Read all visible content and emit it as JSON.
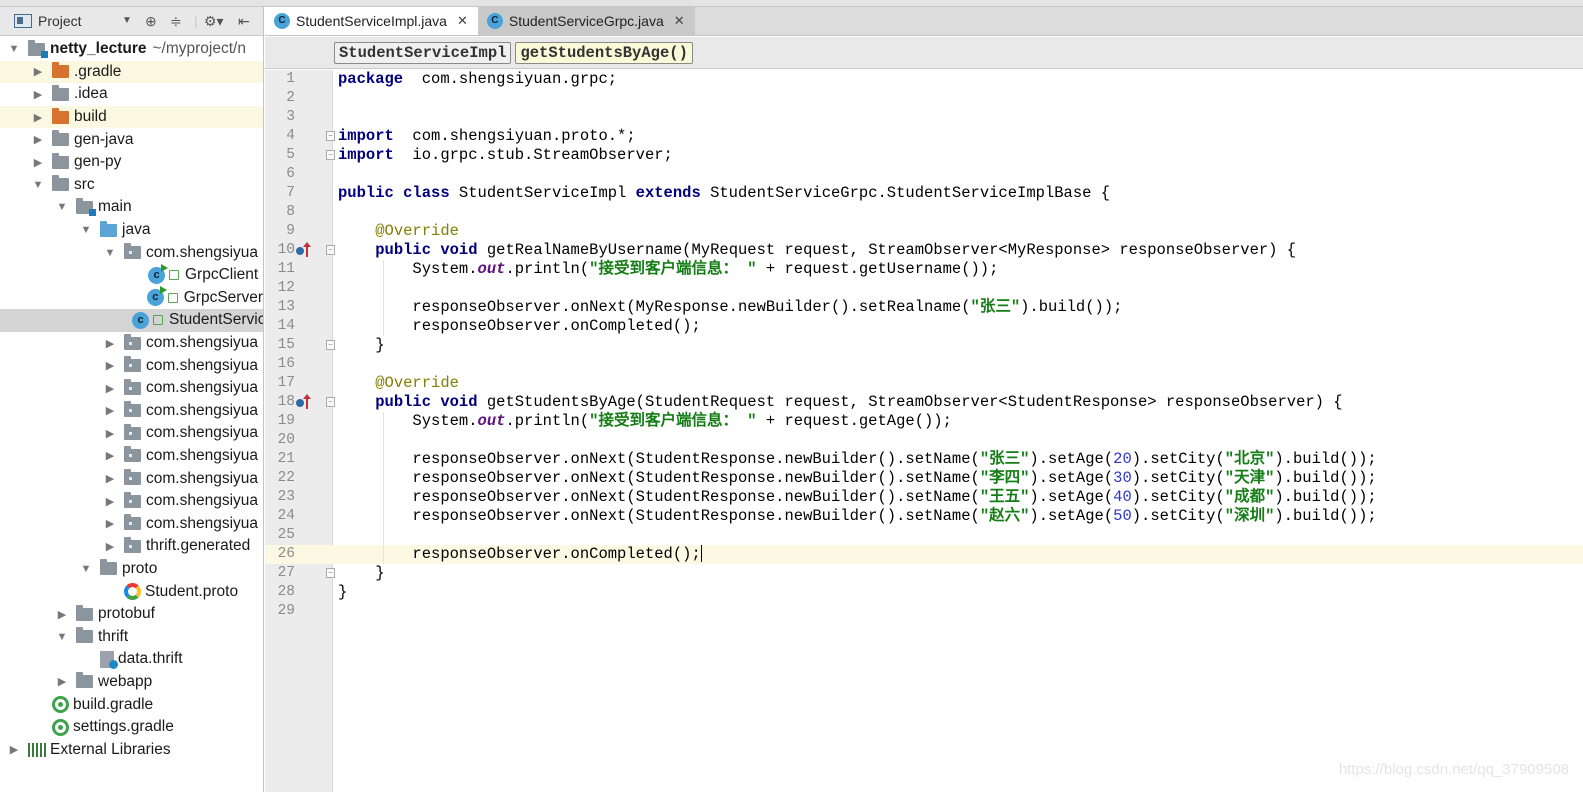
{
  "sidebar": {
    "title": "Project",
    "tools": [
      "dropdown-caret",
      "locate-icon",
      "collapse-icon",
      "settings-icon",
      "hide-icon"
    ],
    "tree": [
      {
        "label": "netty_lecture",
        "path": "~/myproject/n",
        "icon": "module-folder",
        "depth": 0,
        "expanded": true,
        "bold": true
      },
      {
        "label": ".gradle",
        "icon": "folder-orange",
        "depth": 1,
        "expanded": false,
        "highlight": true
      },
      {
        "label": ".idea",
        "icon": "folder",
        "depth": 1,
        "expanded": false
      },
      {
        "label": "build",
        "icon": "folder-orange",
        "depth": 1,
        "expanded": false,
        "highlight": true
      },
      {
        "label": "gen-java",
        "icon": "folder",
        "depth": 1,
        "expanded": false
      },
      {
        "label": "gen-py",
        "icon": "folder",
        "depth": 1,
        "expanded": false
      },
      {
        "label": "src",
        "icon": "folder",
        "depth": 1,
        "expanded": true
      },
      {
        "label": "main",
        "icon": "module-folder",
        "depth": 2,
        "expanded": true
      },
      {
        "label": "java",
        "icon": "source-folder",
        "depth": 3,
        "expanded": true
      },
      {
        "label": "com.shengsiyua",
        "icon": "package",
        "depth": 4,
        "expanded": true
      },
      {
        "label": "GrpcClient",
        "icon": "class-runnable",
        "depth": 5
      },
      {
        "label": "GrpcServer",
        "icon": "class-runnable",
        "depth": 5
      },
      {
        "label": "StudentServiceImpl",
        "icon": "class",
        "depth": 5,
        "selected": true
      },
      {
        "label": "com.shengsiyua",
        "icon": "package",
        "depth": 4,
        "expanded": false
      },
      {
        "label": "com.shengsiyua",
        "icon": "package",
        "depth": 4,
        "expanded": false
      },
      {
        "label": "com.shengsiyua",
        "icon": "package",
        "depth": 4,
        "expanded": false
      },
      {
        "label": "com.shengsiyua",
        "icon": "package",
        "depth": 4,
        "expanded": false
      },
      {
        "label": "com.shengsiyua",
        "icon": "package",
        "depth": 4,
        "expanded": false
      },
      {
        "label": "com.shengsiyua",
        "icon": "package",
        "depth": 4,
        "expanded": false
      },
      {
        "label": "com.shengsiyua",
        "icon": "package",
        "depth": 4,
        "expanded": false
      },
      {
        "label": "com.shengsiyua",
        "icon": "package",
        "depth": 4,
        "expanded": false
      },
      {
        "label": "com.shengsiyua",
        "icon": "package",
        "depth": 4,
        "expanded": false
      },
      {
        "label": "thrift.generated",
        "icon": "package",
        "depth": 4,
        "expanded": false
      },
      {
        "label": "proto",
        "icon": "folder",
        "depth": 3,
        "expanded": true
      },
      {
        "label": "Student.proto",
        "icon": "proto-file",
        "depth": 4
      },
      {
        "label": "protobuf",
        "icon": "folder",
        "depth": 2,
        "expanded": false
      },
      {
        "label": "thrift",
        "icon": "folder",
        "depth": 2,
        "expanded": true
      },
      {
        "label": "data.thrift",
        "icon": "thrift-file",
        "depth": 3
      },
      {
        "label": "webapp",
        "icon": "folder",
        "depth": 2,
        "expanded": false
      },
      {
        "label": "build.gradle",
        "icon": "gradle-file",
        "depth": 1
      },
      {
        "label": "settings.gradle",
        "icon": "gradle-file",
        "depth": 1
      },
      {
        "label": "External Libraries",
        "icon": "libraries",
        "depth": 0,
        "expanded": false
      }
    ]
  },
  "tabs": [
    {
      "label": "StudentServiceImpl.java",
      "active": true
    },
    {
      "label": "StudentServiceGrpc.java",
      "active": false
    }
  ],
  "breadcrumb": [
    "StudentServiceImpl",
    "getStudentsByAge()"
  ],
  "editor": {
    "caret_line": 26,
    "override_markers": [
      10,
      18
    ],
    "fold_markers": [
      4,
      5,
      10,
      15,
      18,
      27
    ],
    "lines": [
      [
        [
          "kw",
          "package"
        ],
        [
          "",
          "  com.shengsiyuan.grpc;"
        ]
      ],
      [],
      [],
      [
        [
          "kw",
          "import"
        ],
        [
          "",
          "  com.shengsiyuan.proto.*;"
        ]
      ],
      [
        [
          "kw",
          "import"
        ],
        [
          "",
          "  io.grpc.stub.StreamObserver;"
        ]
      ],
      [],
      [
        [
          "kw",
          "public class"
        ],
        [
          "",
          " StudentServiceImpl "
        ],
        [
          "kw",
          "extends"
        ],
        [
          "",
          " StudentServiceGrpc.StudentServiceImplBase {"
        ]
      ],
      [],
      [
        [
          "",
          "    "
        ],
        [
          "ann",
          "@Override"
        ]
      ],
      [
        [
          "",
          "    "
        ],
        [
          "kw",
          "public void"
        ],
        [
          "",
          " getRealNameByUsername(MyRequest request, StreamObserver<MyResponse> responseObserver) {"
        ]
      ],
      [
        [
          "",
          "        System."
        ],
        [
          "static",
          "out"
        ],
        [
          "",
          ".println("
        ],
        [
          "str",
          "\"接受到客户端信息： \""
        ],
        [
          "",
          " + request.getUsername());"
        ]
      ],
      [],
      [
        [
          "",
          "        responseObserver.onNext(MyResponse.newBuilder().setRealname("
        ],
        [
          "str",
          "\"张三\""
        ],
        [
          "",
          ").build());"
        ]
      ],
      [
        [
          "",
          "        responseObserver.onCompleted();"
        ]
      ],
      [
        [
          "",
          "    }"
        ]
      ],
      [],
      [
        [
          "",
          "    "
        ],
        [
          "ann",
          "@Override"
        ]
      ],
      [
        [
          "",
          "    "
        ],
        [
          "kw",
          "public void"
        ],
        [
          "",
          " getStudentsByAge(StudentRequest request, StreamObserver<StudentResponse> responseObserver) {"
        ]
      ],
      [
        [
          "",
          "        System."
        ],
        [
          "static",
          "out"
        ],
        [
          "",
          ".println("
        ],
        [
          "str",
          "\"接受到客户端信息： \""
        ],
        [
          "",
          " + request.getAge());"
        ]
      ],
      [],
      [
        [
          "",
          "        responseObserver.onNext(StudentResponse.newBuilder().setName("
        ],
        [
          "str",
          "\"张三\""
        ],
        [
          "",
          ").setAge("
        ],
        [
          "num",
          "20"
        ],
        [
          "",
          ").setCity("
        ],
        [
          "str",
          "\"北京\""
        ],
        [
          "",
          ").build());"
        ]
      ],
      [
        [
          "",
          "        responseObserver.onNext(StudentResponse.newBuilder().setName("
        ],
        [
          "str",
          "\"李四\""
        ],
        [
          "",
          ").setAge("
        ],
        [
          "num",
          "30"
        ],
        [
          "",
          ").setCity("
        ],
        [
          "str",
          "\"天津\""
        ],
        [
          "",
          ").build());"
        ]
      ],
      [
        [
          "",
          "        responseObserver.onNext(StudentResponse.newBuilder().setName("
        ],
        [
          "str",
          "\"王五\""
        ],
        [
          "",
          ").setAge("
        ],
        [
          "num",
          "40"
        ],
        [
          "",
          ").setCity("
        ],
        [
          "str",
          "\"成都\""
        ],
        [
          "",
          ").build());"
        ]
      ],
      [
        [
          "",
          "        responseObserver.onNext(StudentResponse.newBuilder().setName("
        ],
        [
          "str",
          "\"赵六\""
        ],
        [
          "",
          ").setAge("
        ],
        [
          "num",
          "50"
        ],
        [
          "",
          ").setCity("
        ],
        [
          "str",
          "\"深圳\""
        ],
        [
          "",
          ").build());"
        ]
      ],
      [],
      [
        [
          "",
          "        responseObserver.onCompleted();"
        ],
        [
          "cursor",
          ""
        ]
      ],
      [
        [
          "",
          "    }"
        ]
      ],
      [
        [
          "",
          "}"
        ]
      ],
      []
    ]
  },
  "watermark": "https://blog.csdn.net/qq_37909508"
}
